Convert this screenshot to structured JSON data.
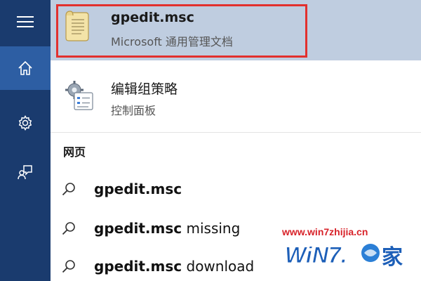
{
  "rail": {
    "items": [
      {
        "name": "menu",
        "icon": "hamburger-icon",
        "selected": false
      },
      {
        "name": "home",
        "icon": "home-icon",
        "selected": true
      },
      {
        "name": "settings",
        "icon": "gear-icon",
        "selected": false
      },
      {
        "name": "feedback",
        "icon": "feedback-icon",
        "selected": false
      }
    ],
    "colors": {
      "background": "#1a3b6e",
      "selected": "#2d5ea3"
    }
  },
  "best_match": {
    "title": "gpedit.msc",
    "subtitle": "Microsoft 通用管理文档",
    "icon": "document-icon",
    "highlight_color": "#e2302e",
    "background": "#bfcde0"
  },
  "app_result": {
    "title": "编辑组策略",
    "subtitle": "控制面板",
    "icon": "control-panel-icon"
  },
  "web_section": {
    "header": "网页",
    "results": [
      {
        "query": "gpedit.msc",
        "suffix": ""
      },
      {
        "query": "gpedit.msc",
        "suffix": " missing"
      },
      {
        "query": "gpedit.msc",
        "suffix": " download"
      }
    ]
  },
  "watermark": {
    "url": "www.win7zhijia.cn",
    "logo_text": "WiN7.",
    "logo_tail": "家"
  }
}
